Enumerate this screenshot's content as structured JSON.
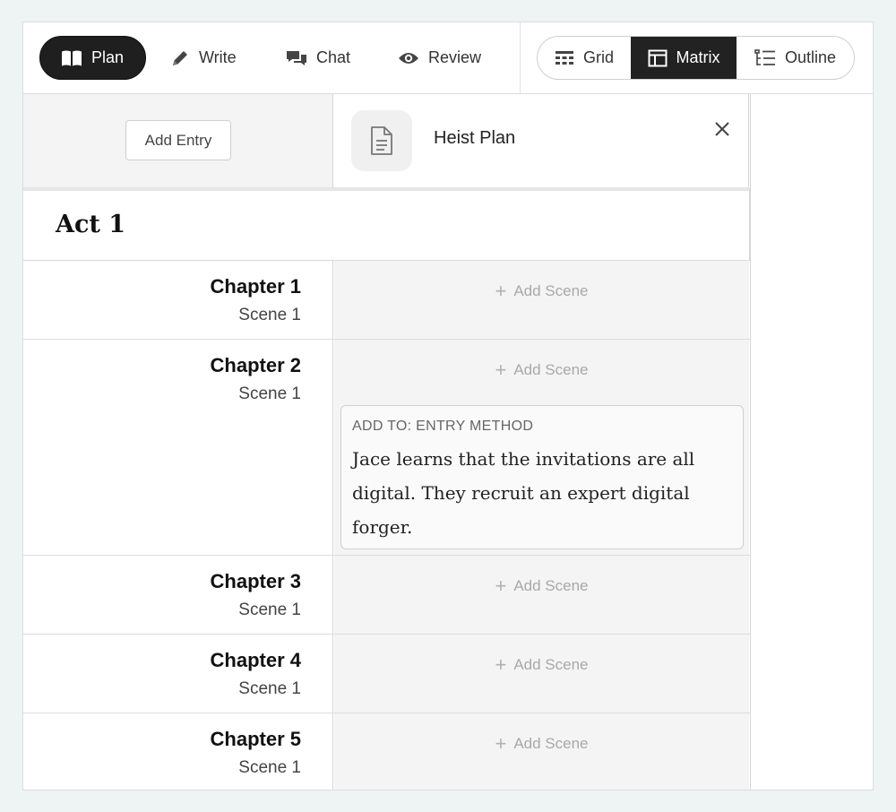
{
  "toolbar": {
    "modes": [
      {
        "label": "Plan",
        "icon": "book-icon",
        "active": true
      },
      {
        "label": "Write",
        "icon": "pencil-icon",
        "active": false
      },
      {
        "label": "Chat",
        "icon": "chat-icon",
        "active": false
      },
      {
        "label": "Review",
        "icon": "eye-icon",
        "active": false
      }
    ],
    "views": [
      {
        "label": "Grid",
        "icon": "grid-icon",
        "active": false
      },
      {
        "label": "Matrix",
        "icon": "matrix-icon",
        "active": true
      },
      {
        "label": "Outline",
        "icon": "outline-icon",
        "active": false
      }
    ]
  },
  "entry_header": {
    "add_entry_label": "Add Entry",
    "plan_title": "Heist Plan",
    "plan_icon": "document-icon"
  },
  "act": {
    "title": "Act 1"
  },
  "add_scene_label": "Add Scene",
  "chapters": [
    {
      "name": "Chapter 1",
      "scene": "Scene 1"
    },
    {
      "name": "Chapter 2",
      "scene": "Scene 1"
    },
    {
      "name": "Chapter 3",
      "scene": "Scene 1"
    },
    {
      "name": "Chapter 4",
      "scene": "Scene 1"
    },
    {
      "name": "Chapter 5",
      "scene": "Scene 1"
    }
  ],
  "suggestion": {
    "label": "ADD TO: ENTRY METHOD",
    "text": "Jace learns that the invitations are all digital. They recruit an expert digital forger."
  },
  "colors": {
    "active_tab_bg": "#1f1f1f",
    "page_bg": "#eef3f3",
    "cell_bg": "#f4f4f4"
  }
}
